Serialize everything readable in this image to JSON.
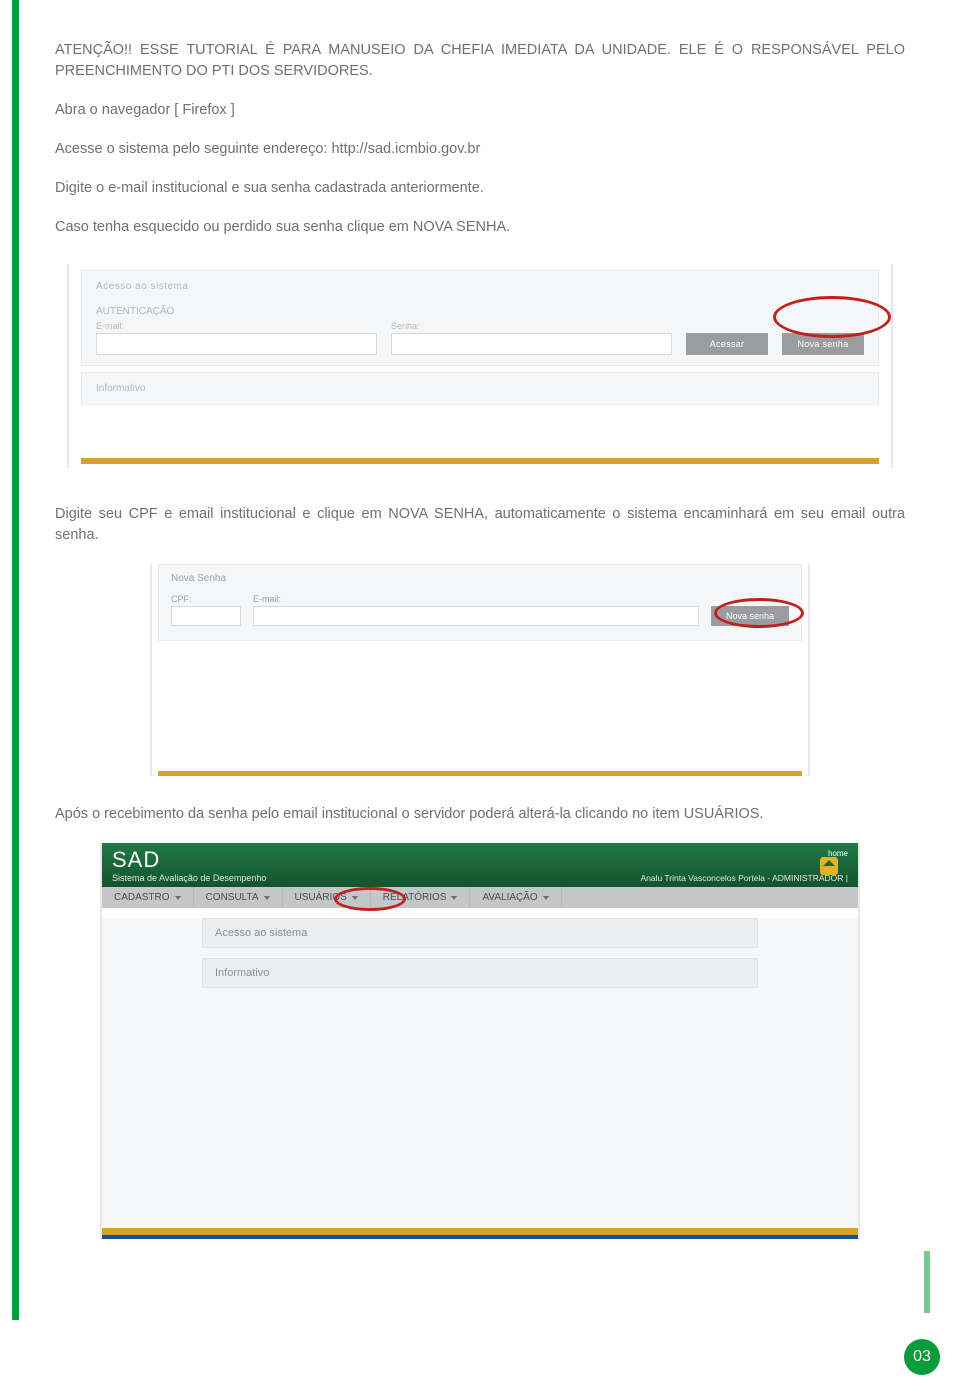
{
  "intro": {
    "p1": "ATENÇÃO!! ESSE TUTORIAL É PARA MANUSEIO DA CHEFIA IMEDIATA DA UNIDADE. ELE É O RESPONSÁVEL PELO PREENCHIMENTO DO PTI DOS SERVIDORES.",
    "p2": "Abra o navegador [ Firefox ]",
    "p3": "Acesse o sistema pelo seguinte endereço: http://sad.icmbio.gov.br",
    "p4": "Digite o e-mail institucional e sua senha cadastrada anteriormente.",
    "p5": "Caso tenha esquecido ou perdido sua senha clique em NOVA SENHA."
  },
  "shot1": {
    "box_title": "Acesso ao sistema",
    "auth_title": "AUTENTICAÇÃO",
    "email_label": "E-mail:",
    "senha_label": "Senha:",
    "btn_acessar": "Acessar",
    "btn_nova": "Nova senha",
    "info_title": "Informativo"
  },
  "mid1": "Digite seu CPF e email institucional e clique em NOVA SENHA,  automaticamente o sistema encaminhará em seu email outra senha.",
  "shot2": {
    "title": "Nova Senha",
    "cpf_label": "CPF:",
    "email_label": "E-mail:",
    "btn": "Nova senha"
  },
  "mid2": "Após o recebimento da senha pelo email institucional o servidor poderá alterá-la clicando no item USUÁRIOS.",
  "shot3": {
    "logo": "SAD",
    "subtitle": "Sistema de Avaliação de Desempenho",
    "home_label": "home",
    "user_text": "Analu Trinta Vasconcelos Portela - ADMINISTRADOR |",
    "menu": {
      "m1": "CADASTRO",
      "m2": "CONSULTA",
      "m3": "USUÁRIOS",
      "m4": "RELATÓRIOS",
      "m5": "AVALIAÇÃO"
    },
    "panel1": "Acesso ao sistema",
    "panel2": "Informativo"
  },
  "page_number": "03"
}
